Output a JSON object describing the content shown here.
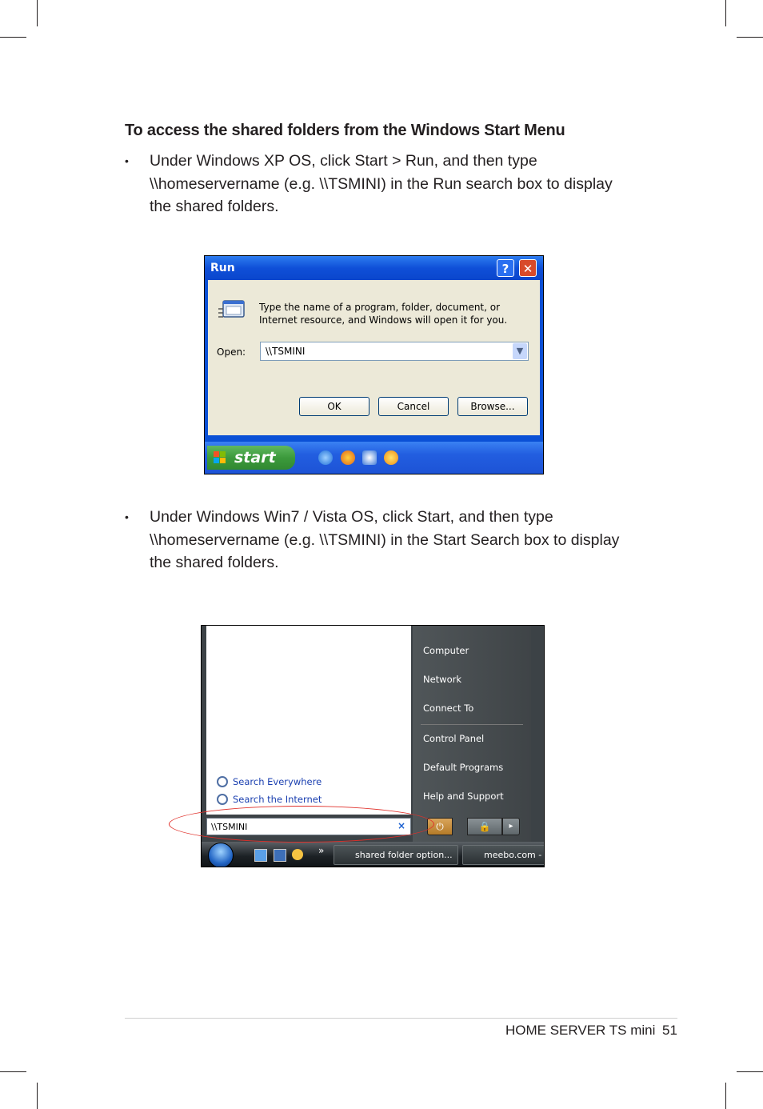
{
  "heading": "To access the shared folders from the Windows Start Menu",
  "bullets": [
    {
      "marker": "•",
      "text": "Under Windows XP OS, click Start > Run, and then type \\\\homeservername (e.g. \\\\TSMINI) in the Run search box to display the shared folders."
    },
    {
      "marker": "•",
      "text": "Under Windows Win7 / Vista OS, click Start, and then type \\\\homeservername (e.g. \\\\TSMINI) in the Start Search box to display the shared folders."
    }
  ],
  "xp_run_dialog": {
    "title": "Run",
    "help_glyph": "?",
    "close_glyph": "✕",
    "description": "Type the name of a program, folder, document, or Internet resource, and Windows will open it for you.",
    "open_label": "Open:",
    "open_value": "\\\\TSMINI",
    "ok_label": "OK",
    "cancel_label": "Cancel",
    "browse_label": "Browse...",
    "start_label": "start",
    "icons": [
      "run-icon",
      "dropdown-arrow-icon",
      "windows-flag-icon",
      "internet-explorer-icon",
      "firefox-icon",
      "outlook-icon",
      "media-player-icon"
    ]
  },
  "vista_start_menu": {
    "right_items_top": [
      "Computer",
      "Network",
      "Connect To"
    ],
    "right_items_bottom": [
      "Control Panel",
      "Default Programs",
      "Help and Support"
    ],
    "search_links": [
      "Search Everywhere",
      "Search the Internet"
    ],
    "search_value": "\\\\TSMINI",
    "clear_glyph": "×",
    "power_glyph": "⏻",
    "lock_glyph": "🔒",
    "arrow_glyph": "▸",
    "quicklaunch_more": "»",
    "taskbar_items": [
      "shared folder option...",
      "meebo.com -"
    ],
    "highlight_color": "#e0302a"
  },
  "footer": {
    "title": "HOME SERVER TS mini",
    "page": "51"
  }
}
